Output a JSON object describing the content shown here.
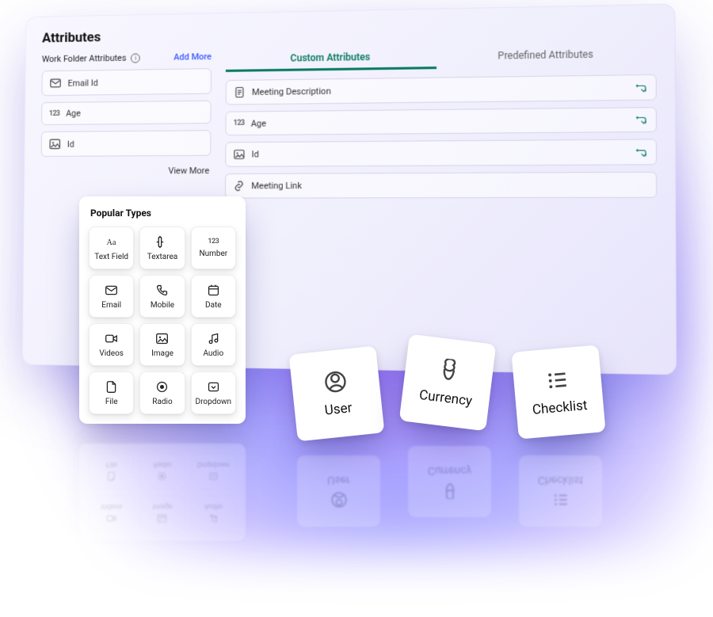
{
  "page": {
    "title": "Attributes"
  },
  "sidebar": {
    "title": "Work Folder Attributes",
    "add_more": "Add More",
    "items": [
      {
        "icon": "mail",
        "label": "Email Id"
      },
      {
        "icon": "num",
        "label": "Age"
      },
      {
        "icon": "image",
        "label": "Id"
      }
    ],
    "view_more": "View More"
  },
  "tabs": {
    "custom": "Custom Attributes",
    "predefined": "Predefined Attributes"
  },
  "custom_rows": [
    {
      "icon": "doc",
      "label": "Meeting Description"
    },
    {
      "icon": "num",
      "label": "Age"
    },
    {
      "icon": "image",
      "label": "Id"
    },
    {
      "icon": "link",
      "label": "Meeting Link"
    }
  ],
  "popular": {
    "title": "Popular Types",
    "items": [
      {
        "icon": "text",
        "label": "Text Field"
      },
      {
        "icon": "textarea",
        "label": "Textarea"
      },
      {
        "icon": "num",
        "label": "Number"
      },
      {
        "icon": "mail",
        "label": "Email"
      },
      {
        "icon": "phone",
        "label": "Mobile"
      },
      {
        "icon": "date",
        "label": "Date"
      },
      {
        "icon": "video",
        "label": "Videos"
      },
      {
        "icon": "image",
        "label": "Image"
      },
      {
        "icon": "audio",
        "label": "Audio"
      },
      {
        "icon": "file",
        "label": "File"
      },
      {
        "icon": "radio",
        "label": "Radio"
      },
      {
        "icon": "dropdown",
        "label": "Dropdown"
      }
    ]
  },
  "float_cards": [
    {
      "icon": "user",
      "label": "User"
    },
    {
      "icon": "currency",
      "label": "Currency"
    },
    {
      "icon": "checklist",
      "label": "Checklist"
    }
  ]
}
